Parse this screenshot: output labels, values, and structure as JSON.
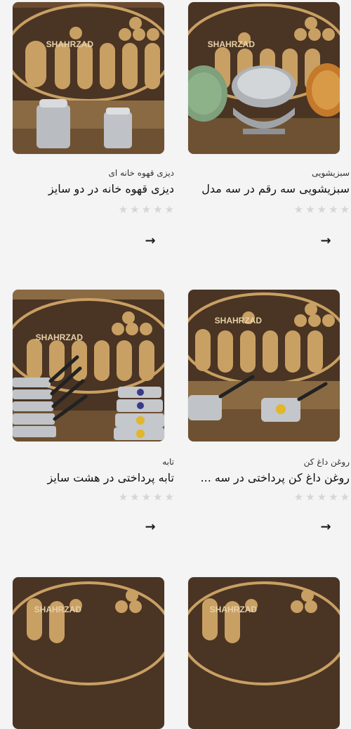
{
  "brand_sign": "SHAHRZAD",
  "products": [
    {
      "category": "دیزی قهوه خانه ای",
      "title": "دیزی قهوه خانه در دو سایز",
      "rating": 0,
      "rating_max": 5,
      "image": "aluminum-pots-photo"
    },
    {
      "category": "سبزیشویی",
      "title": "سبزیشویی سه رقم در سه مدل",
      "rating": 0,
      "rating_max": 5,
      "image": "colanders-photo"
    },
    {
      "category": "تابه",
      "title": "تابه پرداختی در هشت سایز",
      "rating": 0,
      "rating_max": 5,
      "image": "pans-stack-photo"
    },
    {
      "category": "روغن داغ کن",
      "title": "روغن داغ کن پرداختی در سه ...",
      "rating": 0,
      "rating_max": 5,
      "image": "saucepans-photo"
    },
    {
      "category": "",
      "title": "",
      "rating": 0,
      "rating_max": 5,
      "image": "product-photo"
    },
    {
      "category": "",
      "title": "",
      "rating": 0,
      "rating_max": 5,
      "image": "product-photo"
    }
  ],
  "icons": {
    "star": "star-icon",
    "arrow": "arrow-right-icon"
  },
  "colors": {
    "background": "#f4f4f4",
    "star_empty": "#d6d6d6",
    "wood_dark": "#4a3424",
    "wood_light": "#c9a063",
    "metal": "#c9ccd0"
  }
}
